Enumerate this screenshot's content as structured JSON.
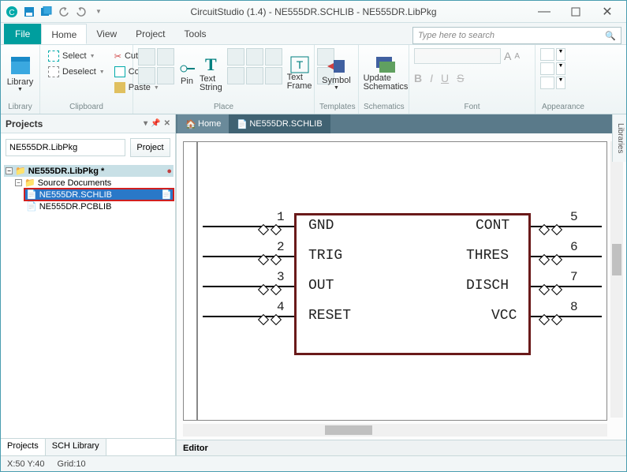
{
  "titlebar": {
    "title": "CircuitStudio (1.4) - NE555DR.SCHLIB - NE555DR.LibPkg"
  },
  "ribbon": {
    "file": "File",
    "tabs": [
      "Home",
      "View",
      "Project",
      "Tools"
    ],
    "active_tab": "Home",
    "search_placeholder": "Type here to search",
    "groups": {
      "library": {
        "label": "Library",
        "btn": "Library"
      },
      "clipboard": {
        "label": "Clipboard",
        "select": "Select",
        "deselect": "Deselect",
        "cut": "Cut",
        "copy": "Copy",
        "paste": "Paste"
      },
      "place": {
        "label": "Place",
        "pin": "Pin",
        "textstring": "Text\nString",
        "textframe": "Text\nFrame"
      },
      "templates": {
        "label": "Templates",
        "symbol": "Symbol"
      },
      "schematics": {
        "label": "Schematics",
        "update": "Update\nSchematics"
      },
      "font": {
        "label": "Font"
      },
      "appearance": {
        "label": "Appearance"
      }
    }
  },
  "doctabs": {
    "home": "Home",
    "active": "NE555DR.SCHLIB"
  },
  "projects": {
    "title": "Projects",
    "filter": "NE555DR.LibPkg",
    "projbtn": "Project",
    "root": "NE555DR.LibPkg *",
    "folder": "Source Documents",
    "items": [
      "NE555DR.SCHLIB",
      "NE555DR.PCBLIB"
    ],
    "bottabs": [
      "Projects",
      "SCH Library"
    ]
  },
  "editor": {
    "label": "Editor"
  },
  "symbol": {
    "left": [
      {
        "no": "1",
        "name": "GND"
      },
      {
        "no": "2",
        "name": "TRIG"
      },
      {
        "no": "3",
        "name": "OUT"
      },
      {
        "no": "4",
        "name": "RESET"
      }
    ],
    "right": [
      {
        "no": "5",
        "name": "CONT"
      },
      {
        "no": "6",
        "name": "THRES"
      },
      {
        "no": "7",
        "name": "DISCH"
      },
      {
        "no": "8",
        "name": "VCC"
      }
    ]
  },
  "rightstrip": "Libraries",
  "status": {
    "xy": "X:50 Y:40",
    "grid": "Grid:10"
  }
}
